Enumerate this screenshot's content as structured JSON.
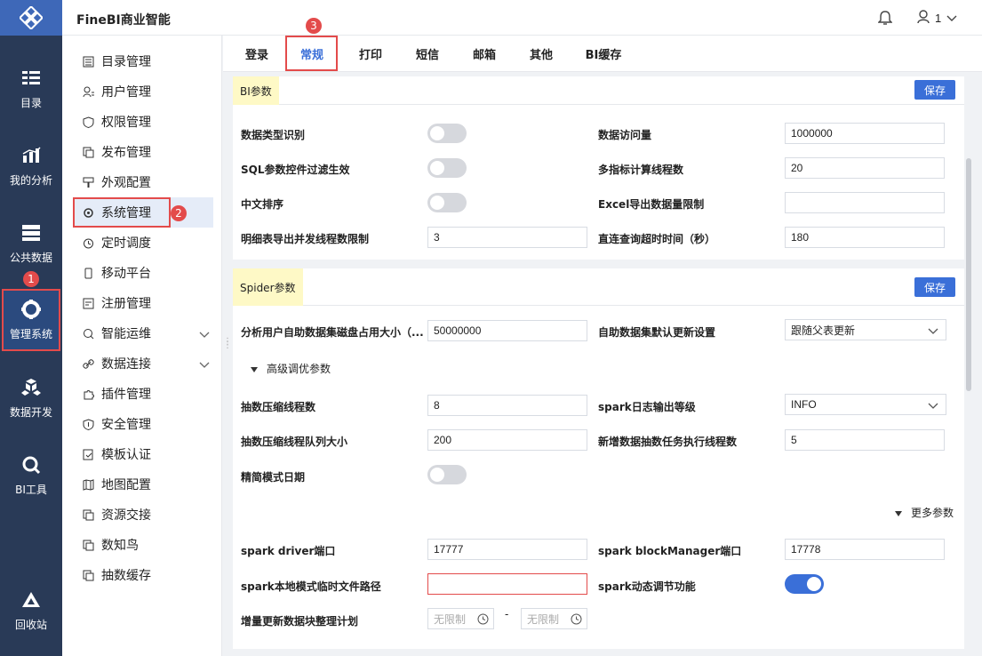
{
  "app": {
    "title": "FineBI商业智能",
    "user": "1"
  },
  "leftnav": [
    {
      "label": "目录",
      "icon": "catalog-icon"
    },
    {
      "label": "我的分析",
      "icon": "analysis-icon"
    },
    {
      "label": "公共数据",
      "icon": "data-icon"
    },
    {
      "label": "管理系统",
      "icon": "admin-icon"
    },
    {
      "label": "数据开发",
      "icon": "dev-icon"
    },
    {
      "label": "BI工具",
      "icon": "tool-icon"
    },
    {
      "label": "回收站",
      "icon": "recycle-icon"
    }
  ],
  "submenu": [
    {
      "label": "目录管理"
    },
    {
      "label": "用户管理"
    },
    {
      "label": "权限管理"
    },
    {
      "label": "发布管理"
    },
    {
      "label": "外观配置"
    },
    {
      "label": "系统管理"
    },
    {
      "label": "定时调度"
    },
    {
      "label": "移动平台"
    },
    {
      "label": "注册管理"
    },
    {
      "label": "智能运维"
    },
    {
      "label": "数据连接"
    },
    {
      "label": "插件管理"
    },
    {
      "label": "安全管理"
    },
    {
      "label": "模板认证"
    },
    {
      "label": "地图配置"
    },
    {
      "label": "资源交接"
    },
    {
      "label": "数知鸟"
    },
    {
      "label": "抽数缓存"
    }
  ],
  "badges": {
    "one": "1",
    "two": "2",
    "three": "3"
  },
  "tabs": [
    "登录",
    "常规",
    "打印",
    "短信",
    "邮箱",
    "其他",
    "BI缓存"
  ],
  "bi": {
    "title": "BI参数",
    "save": "保存",
    "data_type_label": "数据类型识别",
    "sql_filter_label": "SQL参数控件过滤生效",
    "chinese_sort_label": "中文排序",
    "detail_export_label": "明细表导出并发线程数限制",
    "detail_export_value": "3",
    "access_label": "数据访问量",
    "access_value": "1000000",
    "multi_label": "多指标计算线程数",
    "multi_value": "20",
    "excel_label": "Excel导出数据量限制",
    "excel_value": "",
    "direct_label": "直连查询超时时间（秒）",
    "direct_value": "180"
  },
  "spider": {
    "title": "Spider参数",
    "save": "保存",
    "disk_label": "分析用户自助数据集磁盘占用大小（...",
    "disk_value": "50000000",
    "auto_update_label": "自助数据集默认更新设置",
    "auto_update_value": "跟随父表更新",
    "advanced_label": "高级调优参数",
    "compress_threads_label": "抽数压缩线程数",
    "compress_threads_value": "8",
    "log_level_label": "spark日志输出等级",
    "log_level_value": "INFO",
    "queue_label": "抽数压缩线程队列大小",
    "queue_value": "200",
    "new_task_label": "新增数据抽数任务执行线程数",
    "new_task_value": "5",
    "simple_date_label": "精简模式日期",
    "more_label": "更多参数",
    "driver_port_label": "spark driver端口",
    "driver_port_value": "17777",
    "block_port_label": "spark blockManager端口",
    "block_port_value": "17778",
    "tmp_path_label": "spark本地模式临时文件路径",
    "tmp_path_value": "",
    "dynamic_label": "spark动态调节功能",
    "plan_label": "增量更新数据块整理计划",
    "plan_from": "无限制",
    "plan_sep": "-",
    "plan_to": "无限制"
  }
}
